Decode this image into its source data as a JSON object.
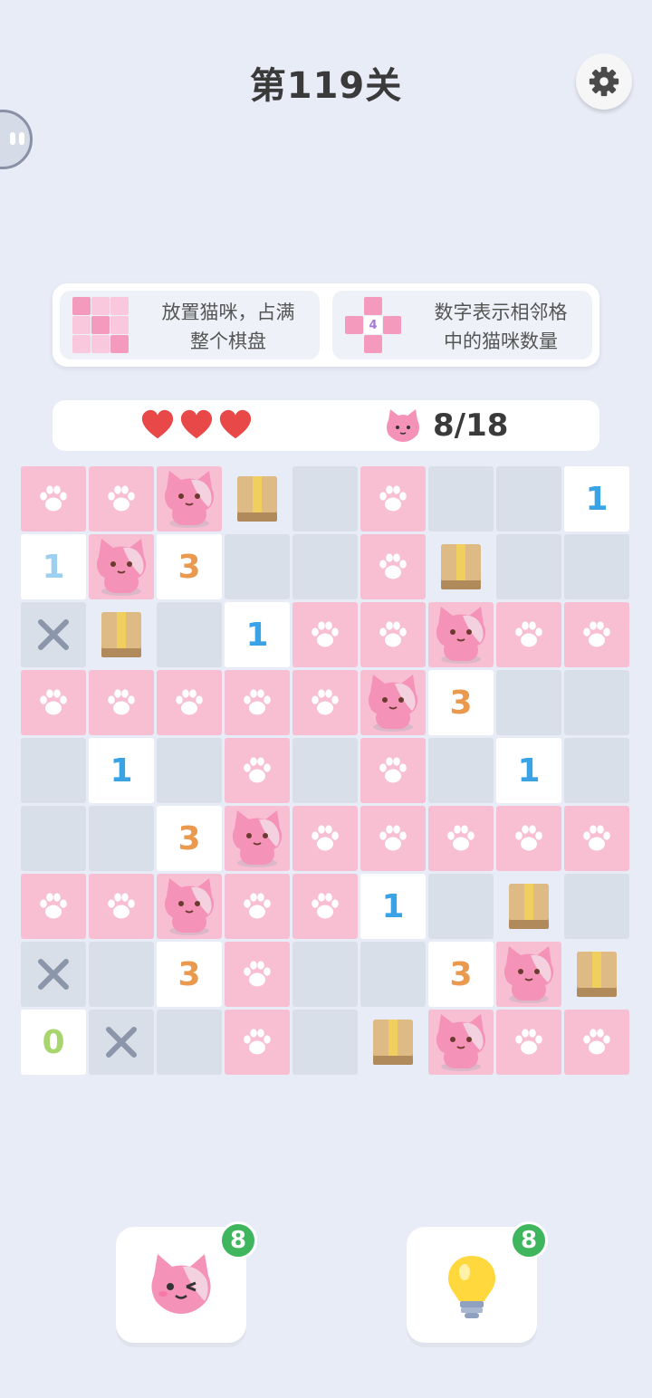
{
  "header": {
    "title": "第119关",
    "settings_icon": "gear-icon"
  },
  "hints": [
    {
      "text_line1": "放置猫咪，占满",
      "text_line2": "整个棋盘"
    },
    {
      "text_line1": "数字表示相邻格",
      "text_line2": "中的猫咪数量",
      "example_number": "4"
    }
  ],
  "status": {
    "lives": 3,
    "cat_icon": "cat-face-icon",
    "counter": "8/18"
  },
  "board": {
    "rows": 9,
    "cols": 9,
    "cells": [
      [
        "paw",
        "paw",
        "cat",
        "box",
        "empty",
        "paw",
        "empty",
        "empty",
        "n1"
      ],
      [
        "n1light",
        "cat",
        "n3",
        "empty",
        "empty",
        "paw",
        "box",
        "empty",
        "empty"
      ],
      [
        "x",
        "box",
        "empty",
        "n1",
        "paw",
        "paw",
        "cat",
        "paw",
        "paw"
      ],
      [
        "paw",
        "paw",
        "paw",
        "paw",
        "paw",
        "cat",
        "n3",
        "empty",
        "empty"
      ],
      [
        "empty",
        "n1",
        "empty",
        "paw",
        "empty",
        "paw",
        "empty",
        "n1",
        "empty"
      ],
      [
        "empty",
        "empty",
        "n3",
        "cat",
        "paw",
        "paw",
        "paw",
        "paw",
        "paw"
      ],
      [
        "paw",
        "paw",
        "cat",
        "paw",
        "paw",
        "n1",
        "empty",
        "box",
        "empty"
      ],
      [
        "x",
        "empty",
        "n3",
        "paw",
        "empty",
        "empty",
        "n3",
        "cat",
        "box"
      ],
      [
        "n0",
        "x",
        "empty",
        "paw",
        "empty",
        "box",
        "cat",
        "paw",
        "paw"
      ]
    ],
    "labels": {
      "n0": "0",
      "n1": "1",
      "n1light": "1",
      "n3": "3"
    }
  },
  "buttons": {
    "cat_button": {
      "icon": "winking-cat-icon",
      "badge": "8"
    },
    "hint_button": {
      "icon": "lightbulb-icon",
      "badge": "8"
    }
  },
  "colors": {
    "pink": "#f8bed2",
    "gray": "#d9dfe8",
    "blue_number": "#3aa3e6",
    "orange_number": "#e99a4e",
    "green_number": "#a8d56e",
    "badge": "#3fb55d"
  }
}
